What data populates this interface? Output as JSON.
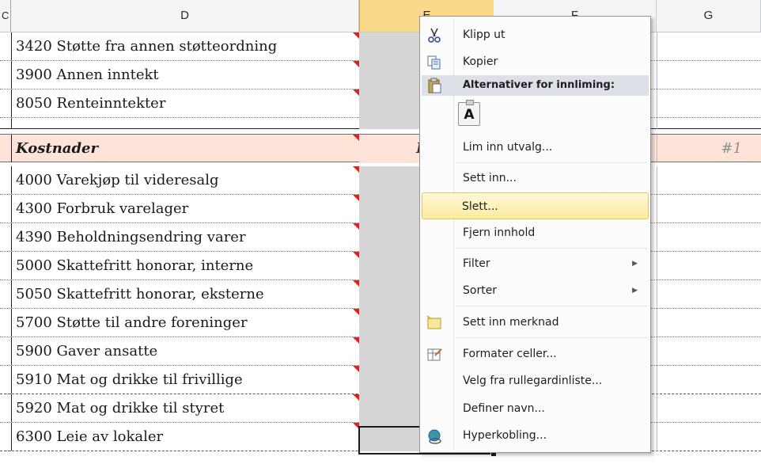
{
  "columns": [
    "C",
    "D",
    "E",
    "F",
    "G"
  ],
  "rows": [
    {
      "label": "3420 Støtte fra annen støtteordning",
      "type": "normal"
    },
    {
      "label": "3900 Annen inntekt",
      "type": "normal"
    },
    {
      "label": "8050 Renteinntekter",
      "type": "normal"
    },
    {
      "label": "",
      "type": "empty"
    },
    {
      "label": "Kostnader",
      "type": "header",
      "e_text": "I",
      "g_text": "#1"
    },
    {
      "label": "4000 Varekjøp til videresalg",
      "type": "normal"
    },
    {
      "label": "4300 Forbruk varelager",
      "type": "normal"
    },
    {
      "label": "4390 Beholdningsendring varer",
      "type": "normal"
    },
    {
      "label": "5000 Skattefritt honorar, interne",
      "type": "normal"
    },
    {
      "label": "5050 Skattefritt honorar, eksterne",
      "type": "normal"
    },
    {
      "label": "5700 Støtte til andre foreninger",
      "type": "normal"
    },
    {
      "label": "5900 Gaver ansatte",
      "type": "normal"
    },
    {
      "label": "5910 Mat og drikke til frivillige",
      "type": "normal"
    },
    {
      "label": "5920 Mat og drikke til styret",
      "type": "normal"
    },
    {
      "label": "6300 Leie av lokaler",
      "type": "normal"
    }
  ],
  "context_menu": {
    "cut": "Klipp ut",
    "copy": "Kopier",
    "paste_options_header": "Alternativer for innliming:",
    "paste_option_glyph": "A",
    "paste_special": "Lim inn utvalg...",
    "insert": "Sett inn...",
    "delete": "Slett...",
    "clear_contents": "Fjern innhold",
    "filter": "Filter",
    "sort": "Sorter",
    "insert_comment": "Sett inn merknad",
    "format_cells": "Formater celler...",
    "pick_from_list": "Velg fra rullegardinliste...",
    "define_name": "Definer navn...",
    "hyperlink": "Hyperkobling...",
    "submenu_arrow": "▶"
  }
}
